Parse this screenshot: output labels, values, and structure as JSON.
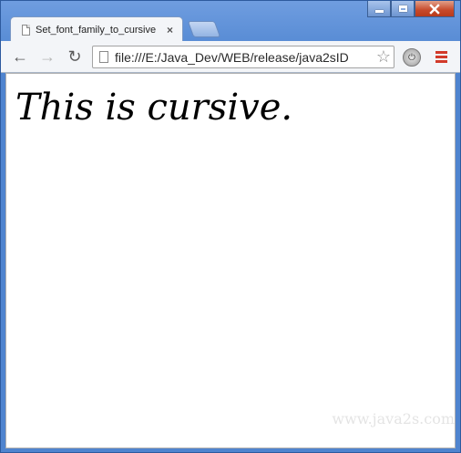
{
  "browser": {
    "tab_title": "Set_font_family_to_cursive",
    "tab_close_symbol": "×",
    "address": "file:///E:/Java_Dev/WEB/release/java2sID",
    "icons": {
      "back": "←",
      "forward": "→",
      "reload": "↻",
      "star": "☆",
      "extension": "⏻"
    }
  },
  "page": {
    "heading": "This is cursive.",
    "watermark": "www.java2s.com"
  }
}
